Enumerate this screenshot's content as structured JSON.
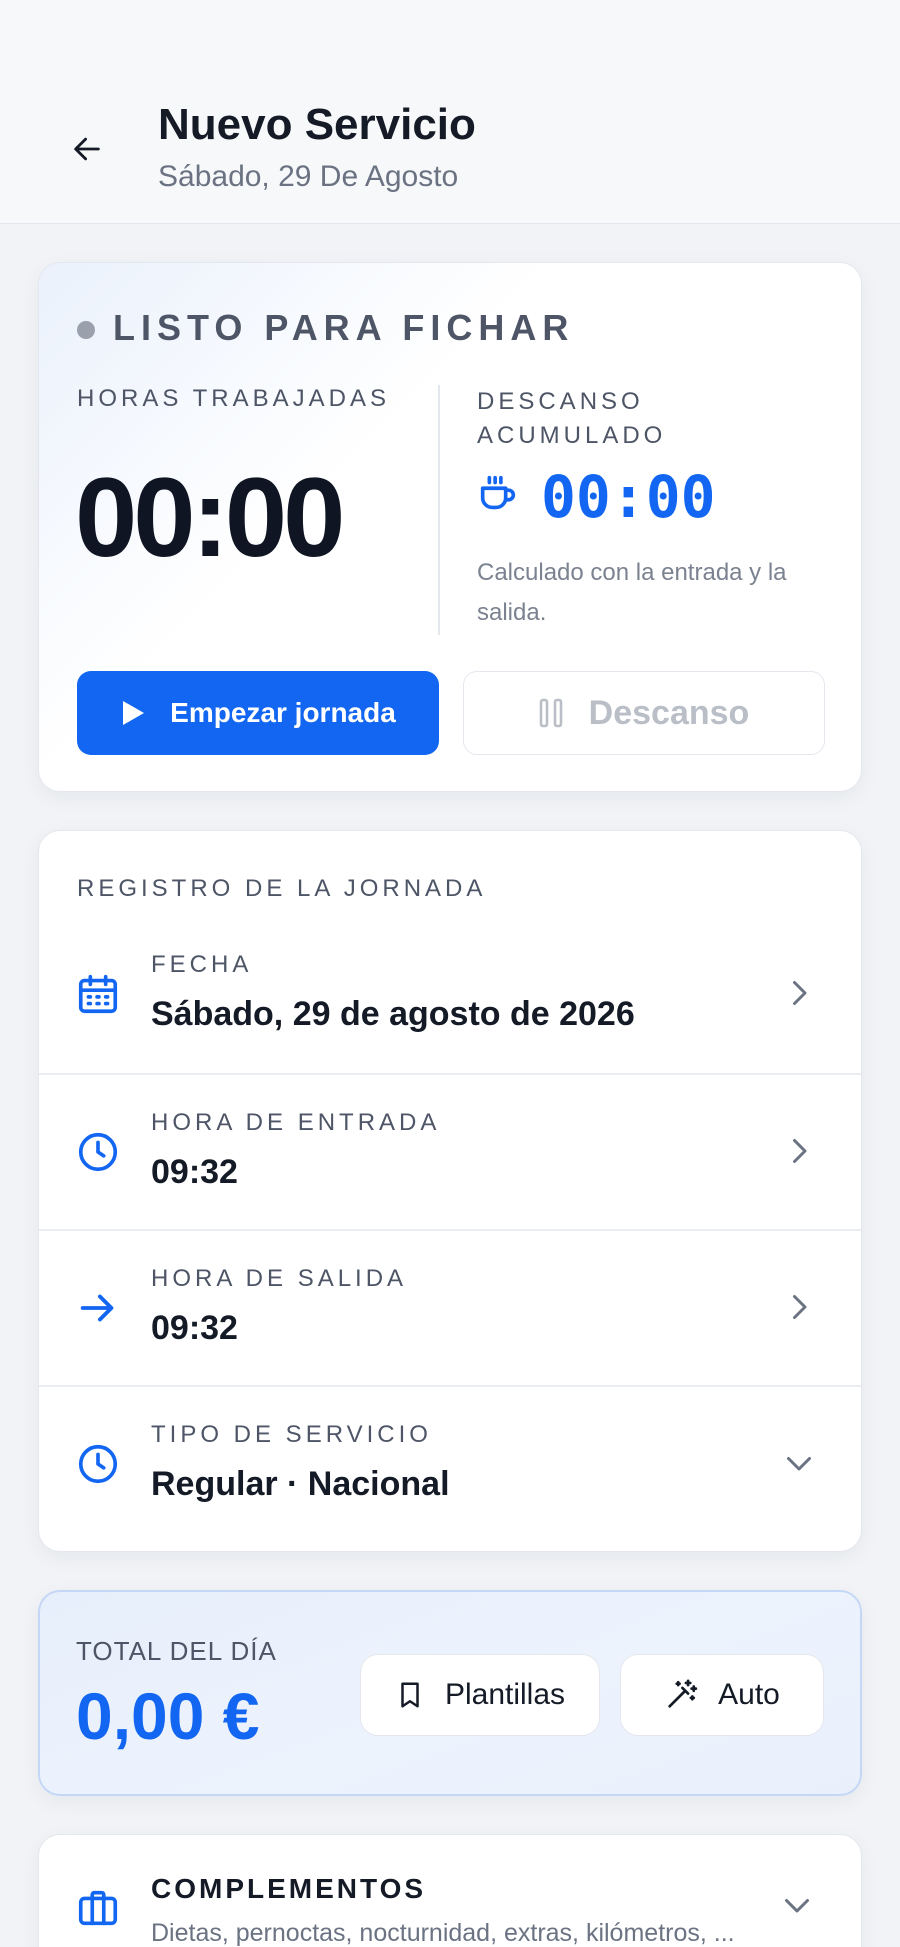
{
  "header": {
    "title": "Nuevo Servicio",
    "subtitle": "Sábado, 29 De Agosto"
  },
  "status": {
    "label": "LISTO PARA FICHAR",
    "hours_caption": "HORAS TRABAJADAS",
    "hours_value": "00:00",
    "break_caption_line1": "DESCANSO",
    "break_caption_line2": "ACUMULADO",
    "break_value": "00:00",
    "break_note": "Calculado con la entrada y la salida.",
    "start_button": "Empezar jornada",
    "break_button": "Descanso"
  },
  "register": {
    "caption": "REGISTRO DE LA JORNADA",
    "rows": [
      {
        "caption": "FECHA",
        "value": "Sábado, 29 de agosto de 2026",
        "icon": "calendar-icon"
      },
      {
        "caption": "HORA DE ENTRADA",
        "value": "09:32",
        "icon": "clock-icon"
      },
      {
        "caption": "HORA DE SALIDA",
        "value": "09:32",
        "icon": "arrow-right-icon"
      },
      {
        "caption": "TIPO DE SERVICIO",
        "value": "Regular · Nacional",
        "icon": "clock-icon"
      }
    ]
  },
  "total": {
    "caption": "TOTAL DEL DÍA",
    "value": "0,00 €",
    "templates_button": "Plantillas",
    "auto_button": "Auto"
  },
  "complements": {
    "title": "COMPLEMENTOS",
    "description": "Dietas, pernoctas, nocturnidad, extras, kilómetros, ..."
  },
  "colors": {
    "accent": "#1266f1",
    "text": "#141a26",
    "muted": "#6b7383",
    "background": "#f1f3f6"
  }
}
